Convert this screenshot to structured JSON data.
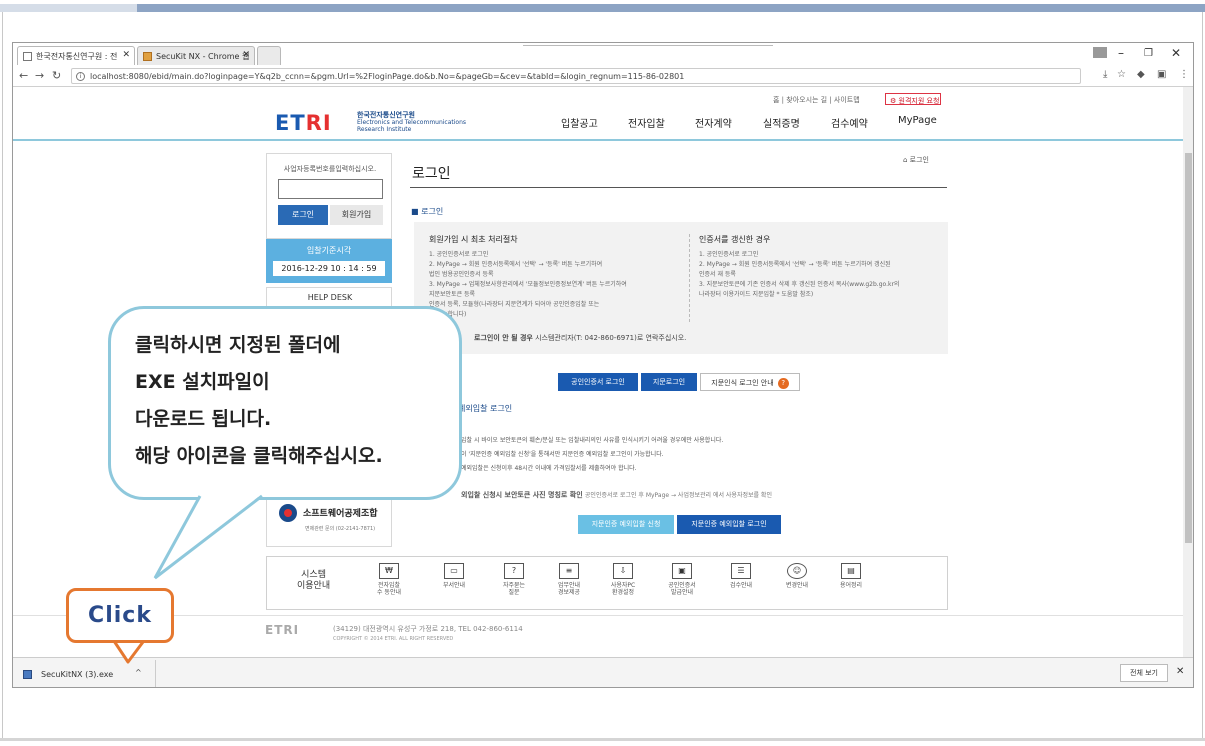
{
  "browser": {
    "tabs": [
      {
        "label": "한국전자통신연구원 : 전"
      },
      {
        "label": "SecuKit NX - Chrome 웹"
      }
    ],
    "url": "localhost:8080/ebid/main.do?loginpage=Y&q2b_ccnn=&pgm.Url=%2FloginPage.do&b.No=&pageGb=&cev=&tabId=&login_regnum=115-86-02801",
    "win_min": "–",
    "win_restore": "❐",
    "win_close": "✕"
  },
  "site": {
    "util_links": "홈 | 찾아오시는 길 | 사이트맵",
    "request_btn": "원격지원 요청",
    "logo": {
      "et": "ET",
      "ri": "RI",
      "sub1": "한국전자통신연구원",
      "sub2": "Electronics and Telecommunications",
      "sub3": "Research Institute"
    },
    "nav": [
      "입찰공고",
      "전자입찰",
      "전자계약",
      "실적증명",
      "검수예약",
      "MyPage"
    ],
    "breadcrumb": "로그인",
    "page_title": "로그인",
    "login_box": {
      "label": "사업자등록번호를입력하십시오.",
      "login_btn": "로그인",
      "join_btn": "회원가입"
    },
    "time_box": {
      "title": "입찰기준시각",
      "time": "2016-12-29 10 : 14 : 59"
    },
    "helpdesk": "HELP DESK",
    "sw_union": {
      "name": "소프트웨어공제조합",
      "phone": "면제관련 문의 (02-2141-7871)"
    },
    "section_login": "■ 로그인",
    "first_login": {
      "heading": "회원가입 시 최초 처리절차",
      "lines": [
        "1. 공인인증서로 로그인",
        "2. MyPage → 회원 인증서등록에서 '선택' → '등록' 버튼 누르기하여",
        "   법인 범용공인인증서 등록",
        "3. MyPage → 업체정보사항관리에서 '모듈정보인증정보연계' 버튼 누르기하여",
        "   지문보안토큰 등록",
        "   인증서 등록, 모듈형(나라장터 지문연계가 되어야 공인인증입찰 또는",
        "   이 가능합니다)"
      ]
    },
    "renew_cert": {
      "heading": "인증서를 갱신한 경우",
      "lines": [
        "1. 공인인증서로 로그인",
        "2. MyPage → 회원 인증서등록에서 '선택' → '등록' 버튼 누르기하여 갱신된",
        "   인증서 재 등록",
        "3. 지문보안토큰에 기존 인증서 삭제 후 갱신된 인증서 복사(www.g2b.go.kr의",
        "   나라장터 이용가이드 지문입찰 * 도움말 참조)"
      ]
    },
    "login_note_bold": "로그인이 안 될 경우",
    "login_note": "시스템관리자(T: 042-860-6971)로 연락주십시오.",
    "login_tabs": [
      "공인인증서 로그인",
      "지문로그인",
      "지문인식 로그인 안내"
    ],
    "qmark": "?",
    "section_exception": "예외입찰 로그인",
    "exception_lines": [
      "입찰 시 바이오 보안토큰의 훼손/분실 또는 입찰내리의인 사유를 인식시키기 어려울 경우에만 사용합니다.",
      "이 '지문인증 예외입찰 신청'을 통해서만 지문인증 예외입찰 로그인이 가능합니다.",
      "예외입찰은 신청이후 48시간 이내에 가격입찰서를 제출하여야 합니다."
    ],
    "exception_note_bold": "외입찰 신청시 보안토큰 사진 명칭로 확인",
    "exception_note": "공인인증서로 로그인 후 MyPage → 사업정보관리 에서 사용자정보를 확인",
    "exception_btn1": "지문인증 예외입찰 신청",
    "exception_btn2": "지문인증 예외입찰 로그인",
    "sys_guide": {
      "title1": "시스템",
      "title2": "이용안내",
      "items": [
        {
          "icon": "₩",
          "l1": "전자입찰",
          "l2": "수 동안내"
        },
        {
          "icon": "▭",
          "l1": "부서안내",
          "l2": ""
        },
        {
          "icon": "?",
          "l1": "자주묻는",
          "l2": "질문"
        },
        {
          "icon": "≡",
          "l1": "업무안내",
          "l2": "경보제공"
        },
        {
          "icon": "⇩",
          "l1": "사용자PC",
          "l2": "환경설정"
        },
        {
          "icon": "▣",
          "l1": "공인인증서",
          "l2": "발급안내"
        },
        {
          "icon": "☰",
          "l1": "검수안내",
          "l2": ""
        },
        {
          "icon": "☺",
          "l1": "변경안내",
          "l2": ""
        },
        {
          "icon": "▤",
          "l1": "용어정리",
          "l2": ""
        }
      ]
    },
    "footer": {
      "logo": "ETRI",
      "address": "(34129) 대전광역시 유성구 가정로 218, TEL 042-860-6114",
      "copyright": "COPYRIGHT © 2014 ETRI. ALL RIGHT RESERVED"
    }
  },
  "download_bar": {
    "file": "SecuKitNX (3).exe",
    "caret": "^",
    "show_all": "전체 보기",
    "close": "✕"
  },
  "callout": {
    "lines": [
      "클릭하시면 지정된 폴더에",
      "EXE 설치파일이",
      "다운로드 됩니다.",
      "해당 아이콘을 클릭해주십시오."
    ],
    "click_label": "Click"
  }
}
